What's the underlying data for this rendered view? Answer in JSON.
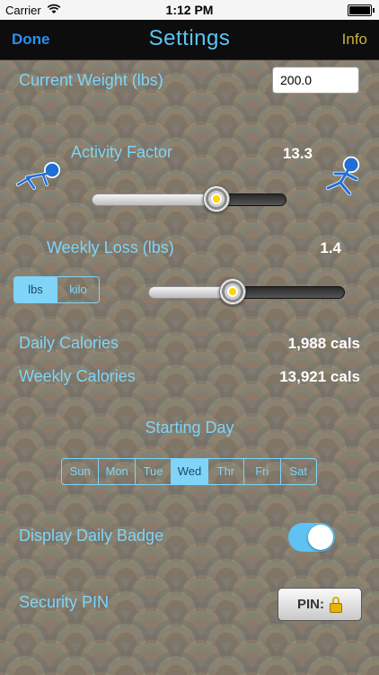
{
  "status_bar": {
    "carrier": "Carrier",
    "time": "1:12 PM"
  },
  "nav": {
    "left_button": "Done",
    "title": "Settings",
    "right_button": "Info"
  },
  "weight": {
    "label": "Current Weight (lbs)",
    "value": "200.0"
  },
  "activity": {
    "label": "Activity Factor",
    "value": "13.3",
    "slider_fraction": 0.64,
    "left_icon": "crawling-person-icon",
    "right_icon": "running-person-icon"
  },
  "weekly_loss": {
    "label": "Weekly Loss (lbs)",
    "value": "1.4",
    "slider_fraction": 0.43,
    "units": [
      "lbs",
      "kilo"
    ],
    "units_selected": "lbs"
  },
  "daily_calories": {
    "label": "Daily Calories",
    "value": "1,988 cals"
  },
  "weekly_calories": {
    "label": "Weekly Calories",
    "value": "13,921 cals"
  },
  "starting_day": {
    "label": "Starting Day",
    "days": [
      "Sun",
      "Mon",
      "Tue",
      "Wed",
      "Thr",
      "Fri",
      "Sat"
    ],
    "selected": "Wed"
  },
  "daily_badge": {
    "label": "Display Daily Badge",
    "enabled": true
  },
  "security_pin": {
    "label": "Security PIN",
    "button_label": "PIN:",
    "button_icon": "lock-icon"
  },
  "colors": {
    "accent": "#7fd4f8",
    "nav_title": "#5cc4f4",
    "done": "#2a8ff0",
    "info": "#c9b040",
    "toggle_on": "#5ec3f2"
  }
}
